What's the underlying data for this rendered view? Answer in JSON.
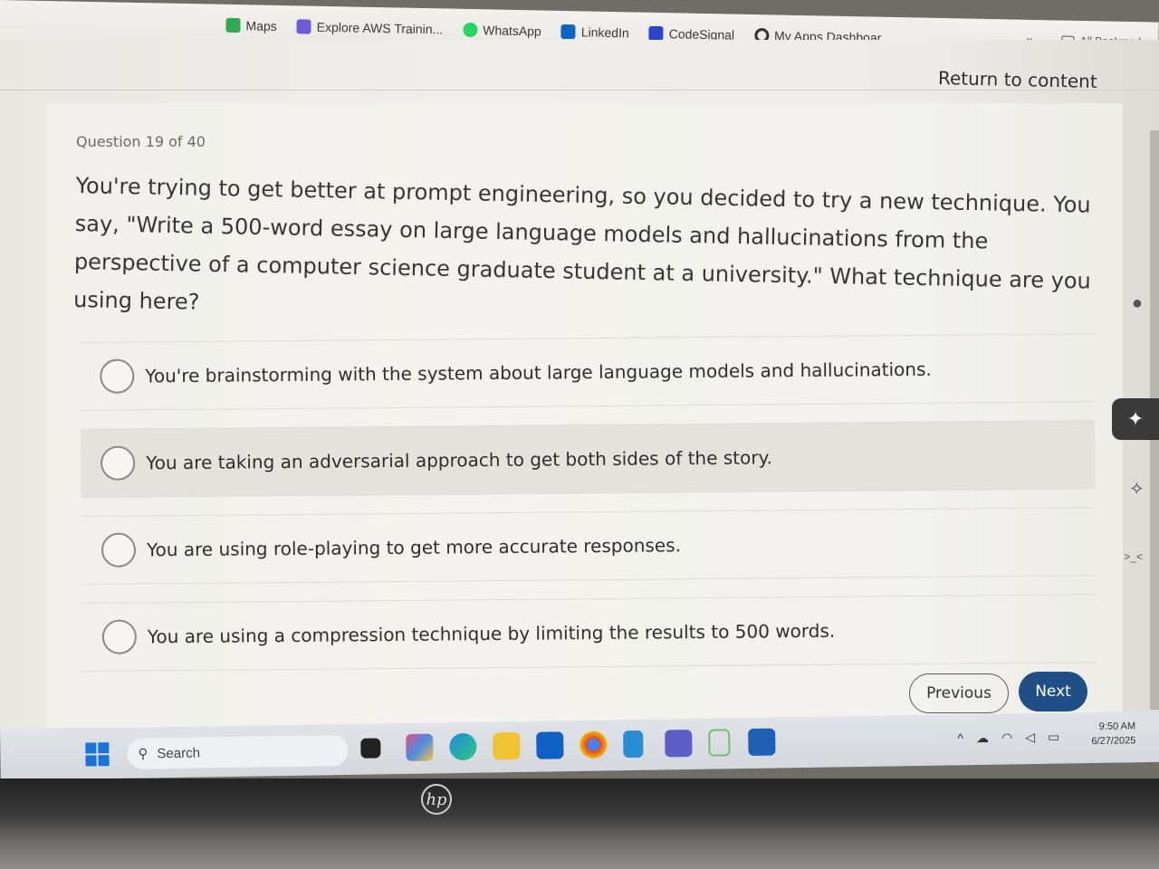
{
  "bookmarks": {
    "items": [
      {
        "label": "Maps",
        "icon": "maps-icon",
        "color": "#34a853"
      },
      {
        "label": "Explore AWS Trainin...",
        "icon": "aws-icon",
        "color": "#6b5bd6"
      },
      {
        "label": "WhatsApp",
        "icon": "whatsapp-icon",
        "color": "#25d366"
      },
      {
        "label": "LinkedIn",
        "icon": "linkedin-icon",
        "color": "#0a66c2"
      },
      {
        "label": "CodeSignal",
        "icon": "codesignal-icon",
        "color": "#2a47c7"
      },
      {
        "label": "My Apps Dashboar...",
        "icon": "okta-icon",
        "color": "#333333"
      }
    ],
    "more": "»",
    "all_bookmarks": "All Bookmarks"
  },
  "page": {
    "return_link": "Return to content",
    "question_count": "Question 19 of 40",
    "question_text": "You're trying to get better at prompt engineering, so you decided to try a new technique. You say, \"Write a 500-word essay on large language models and hallucinations from the perspective of a computer science graduate student at a university.\" What technique are you using here?",
    "options": [
      "You're brainstorming with the system about large language models and hallucinations.",
      "You are taking an adversarial approach to get both sides of the story.",
      "You are using role-playing to get more accurate responses.",
      "You are using a compression technique by limiting the results to 500 words."
    ],
    "previous_label": "Previous",
    "next_label": "Next",
    "accent_color": "#1f4f86"
  },
  "taskbar": {
    "search_label": "Search",
    "time": "9:50 AM",
    "date": "6/27/2025"
  }
}
